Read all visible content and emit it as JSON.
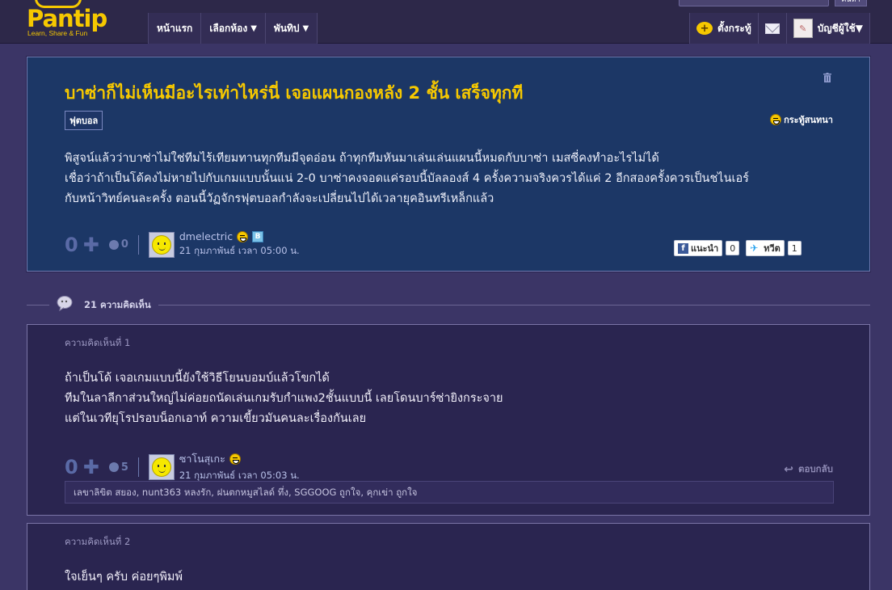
{
  "header": {
    "logo_text": "Pantip",
    "logo_tagline": "Learn, Share & Fun",
    "nav": [
      {
        "label": "หน้าแรก",
        "dropdown": false
      },
      {
        "label": "เลือกห้อง",
        "dropdown": true
      },
      {
        "label": "พันทิป",
        "dropdown": true
      }
    ],
    "new_topic_label": "ตั้งกระทู้",
    "account_label": "บัญชีผู้ใช้",
    "search_button_label": "ค้นหา",
    "caret": "▼"
  },
  "topic": {
    "title": "บาซ่าก็ไม่เห็นมีอะไรเท่าไหร่นี่ เจอแผนกองหลัง 2 ชั้น เสร็จทุกที",
    "tag": "ฟุตบอล",
    "type_label": "กระทู้สนทนา",
    "body_lines": [
      "พิสูจน์แล้วว่าบาซ่าไม่ใช่ทีมไร้เทียมทานทุกทีมมีจุดอ่อน  ถ้าทุกทีมหันมาเล่นเล่นแผนนี้หมดกับบาซ่า เมสซี่คงทำอะไรไม่ได้",
      "เชื่อว่าถ้าเป็นโด้คงไม่หายไปกับเกมแบบนั้นแน่ 2-0 บาซ่าคงจอดแค่รอบนี้บัลลองส์ 4 ครั้งความจริงควรได้แค่ 2  อีกสองครั้งควรเป็นชไนเอร์",
      "กับหน้าวิทย์คนละครั้ง  ตอนนี้วัฏจักรฟุตบอลกำลังจะเปลี่ยนไปได้เวลายุคอินทรีเหล็กแล้ว"
    ],
    "votes": "0",
    "plus": "✚",
    "emotions": "0",
    "author": "dmelectric",
    "author_badge": "B",
    "time": "21 กุมภาพันธ์ เวลา 05:00 น.",
    "fb_label": "แนะนำ",
    "fb_count": "0",
    "tw_label": "ทวีต",
    "tw_count": "1"
  },
  "comments_count_label": "21 ความคิดเห็น",
  "comments": [
    {
      "label": "ความคิดเห็นที่ 1",
      "body_lines": [
        "ถ้าเป็นโด้ เจอเกมแบบนี้ยังใช้วิธีโยนบอมบ์แล้วโขกได้",
        "ทีมในลาลีกาส่วนใหญ่ไม่ค่อยถนัดเล่นเกมรับกำแพง2ชั้นแบบนี้ เลยโดนบาร์ซ่ายิงกระจาย",
        "แต่ในเวทียุโรปรอบน็อกเอาท์ ความเขี้ยวมันคนละเรื่องกันเลย"
      ],
      "votes": "0",
      "plus": "✚",
      "emotions": "5",
      "author": "ซาโนสุเกะ",
      "time": "21 กุมภาพันธ์ เวลา 05:03 น.",
      "reply_label": "ตอบกลับ",
      "likes": "เลขาลิขิต สยอง, nunt363 หลงรัก, ฝนตกหมูสไลด์ ทึ่ง, SGGOOG ถูกใจ, คุกเข่า ถูกใจ"
    },
    {
      "label": "ความคิดเห็นที่ 2",
      "body_lines": [
        "ใจเย็นๆ ครับ ค่อยๆพิมพ์"
      ]
    }
  ],
  "colors": {
    "page_bg": "#3b3566",
    "topic_bg": "#1c3766",
    "comment_bg": "#2a2550",
    "accent_yellow": "#f6c800"
  }
}
